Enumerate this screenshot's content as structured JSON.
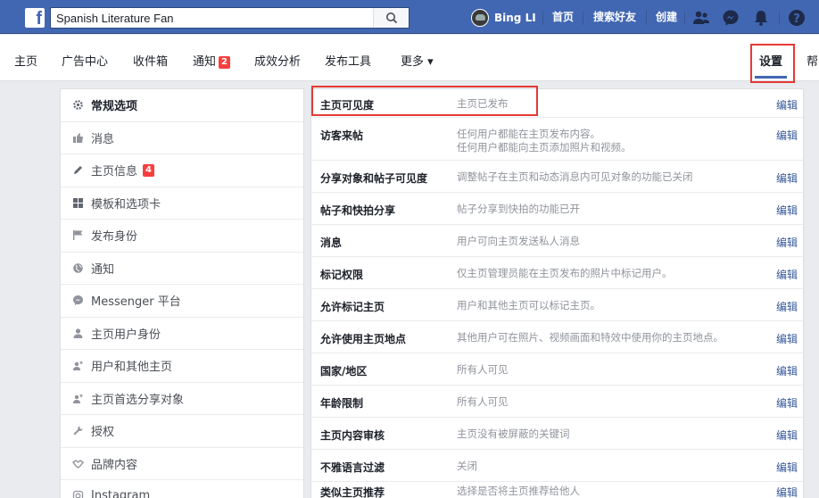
{
  "topbar": {
    "search_value": "Spanish Literature Fan",
    "user_name": "Bing LI",
    "links": [
      "首页",
      "搜索好友",
      "创建"
    ],
    "icons": [
      "friends-icon",
      "messenger-icon",
      "notifications-icon",
      "help-icon"
    ]
  },
  "navbar": {
    "items": [
      {
        "label": "主页"
      },
      {
        "label": "广告中心"
      },
      {
        "label": "收件箱"
      },
      {
        "label": "通知",
        "badge": "2"
      },
      {
        "label": "成效分析"
      },
      {
        "label": "发布工具"
      },
      {
        "label": "更多 ▾"
      }
    ],
    "settings_label": "设置",
    "help_label": "帮"
  },
  "sidebar": {
    "items": [
      {
        "label": "常规选项",
        "icon": "gear-icon",
        "active": true
      },
      {
        "label": "消息",
        "icon": "message-icon"
      },
      {
        "label": "主页信息",
        "icon": "pencil-icon",
        "badge": "4"
      },
      {
        "label": "模板和选项卡",
        "icon": "grid-icon"
      },
      {
        "label": "发布身份",
        "icon": "flag-icon"
      },
      {
        "label": "通知",
        "icon": "globe-icon"
      },
      {
        "label": "Messenger 平台",
        "icon": "messenger-icon"
      },
      {
        "label": "主页用户身份",
        "icon": "person-icon"
      },
      {
        "label": "用户和其他主页",
        "icon": "person-star-icon"
      },
      {
        "label": "主页首选分享对象",
        "icon": "person-star-icon"
      },
      {
        "label": "授权",
        "icon": "wrench-icon"
      },
      {
        "label": "品牌内容",
        "icon": "handshake-icon"
      },
      {
        "label": "Instagram",
        "icon": "instagram-icon"
      }
    ]
  },
  "settings": {
    "edit_label": "编辑",
    "rows": [
      {
        "label": "主页可见度",
        "value": [
          "主页已发布"
        ]
      },
      {
        "label": "访客来帖",
        "value": [
          "任何用户都能在主页发布内容。",
          "任何用户都能向主页添加照片和视频。"
        ]
      },
      {
        "label": "分享对象和帖子可见度",
        "value": [
          "调整帖子在主页和动态消息内可见对象的功能已关闭"
        ]
      },
      {
        "label": "帖子和快拍分享",
        "value": [
          "帖子分享到快拍的功能已开"
        ]
      },
      {
        "label": "消息",
        "value": [
          "用户可向主页发送私人消息"
        ]
      },
      {
        "label": "标记权限",
        "value": [
          "仅主页管理员能在主页发布的照片中标记用户。"
        ]
      },
      {
        "label": "允许标记主页",
        "value": [
          "用户和其他主页可以标记主页。"
        ]
      },
      {
        "label": "允许使用主页地点",
        "value": [
          "其他用户可在照片、视频画面和特效中使用你的主页地点。"
        ]
      },
      {
        "label": "国家/地区",
        "value": [
          "所有人可见"
        ]
      },
      {
        "label": "年龄限制",
        "value": [
          "所有人可见"
        ]
      },
      {
        "label": "主页内容审核",
        "value": [
          "主页没有被屏蔽的关键词"
        ]
      },
      {
        "label": "不雅语言过滤",
        "value": [
          "关闭"
        ]
      },
      {
        "label": "类似主页推荐",
        "value": [
          "选择是否将主页推荐给他人"
        ]
      }
    ]
  },
  "colors": {
    "brand": "#4267b2",
    "highlight_box": "#e53935",
    "badge": "#fa3e3e",
    "link": "#365899"
  }
}
